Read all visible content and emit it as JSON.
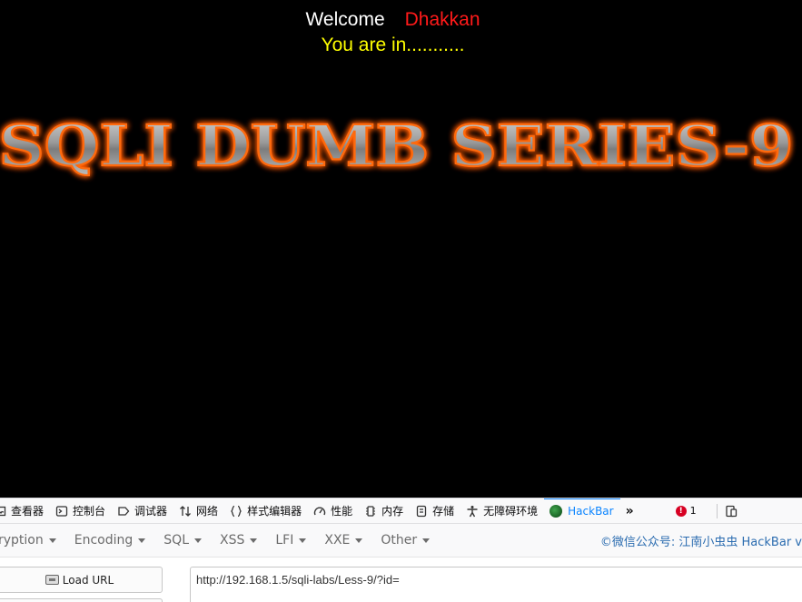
{
  "page": {
    "welcome_label": "Welcome",
    "user_name": "Dhakkan",
    "status_message": "You are in...........",
    "banner_title": "SQLI DUMB SERIES-9"
  },
  "devtools": {
    "tabs": [
      {
        "label": "查看器",
        "icon": "inspector-icon"
      },
      {
        "label": "控制台",
        "icon": "console-icon"
      },
      {
        "label": "调试器",
        "icon": "debugger-icon"
      },
      {
        "label": "网络",
        "icon": "network-icon"
      },
      {
        "label": "样式编辑器",
        "icon": "style-editor-icon"
      },
      {
        "label": "性能",
        "icon": "performance-icon"
      },
      {
        "label": "内存",
        "icon": "memory-icon"
      },
      {
        "label": "存储",
        "icon": "storage-icon"
      },
      {
        "label": "无障碍环境",
        "icon": "accessibility-icon"
      },
      {
        "label": "HackBar",
        "icon": "hackbar-icon"
      }
    ],
    "active_tab": "HackBar",
    "error_count": "1"
  },
  "hackbar": {
    "menus": [
      "ryption",
      "Encoding",
      "SQL",
      "XSS",
      "LFI",
      "XXE",
      "Other"
    ],
    "brand": "©微信公众号: 江南小虫虫 HackBar v",
    "load_url_label": "Load URL",
    "url_value": "http://192.168.1.5/sqli-labs/Less-9/?id="
  },
  "colors": {
    "background": "#000000",
    "welcome": "#ffffff",
    "user_name": "#ff1a1a",
    "status": "#ffff00",
    "banner_glow": "#ff5a00",
    "active_tab": "#0a84ff"
  }
}
